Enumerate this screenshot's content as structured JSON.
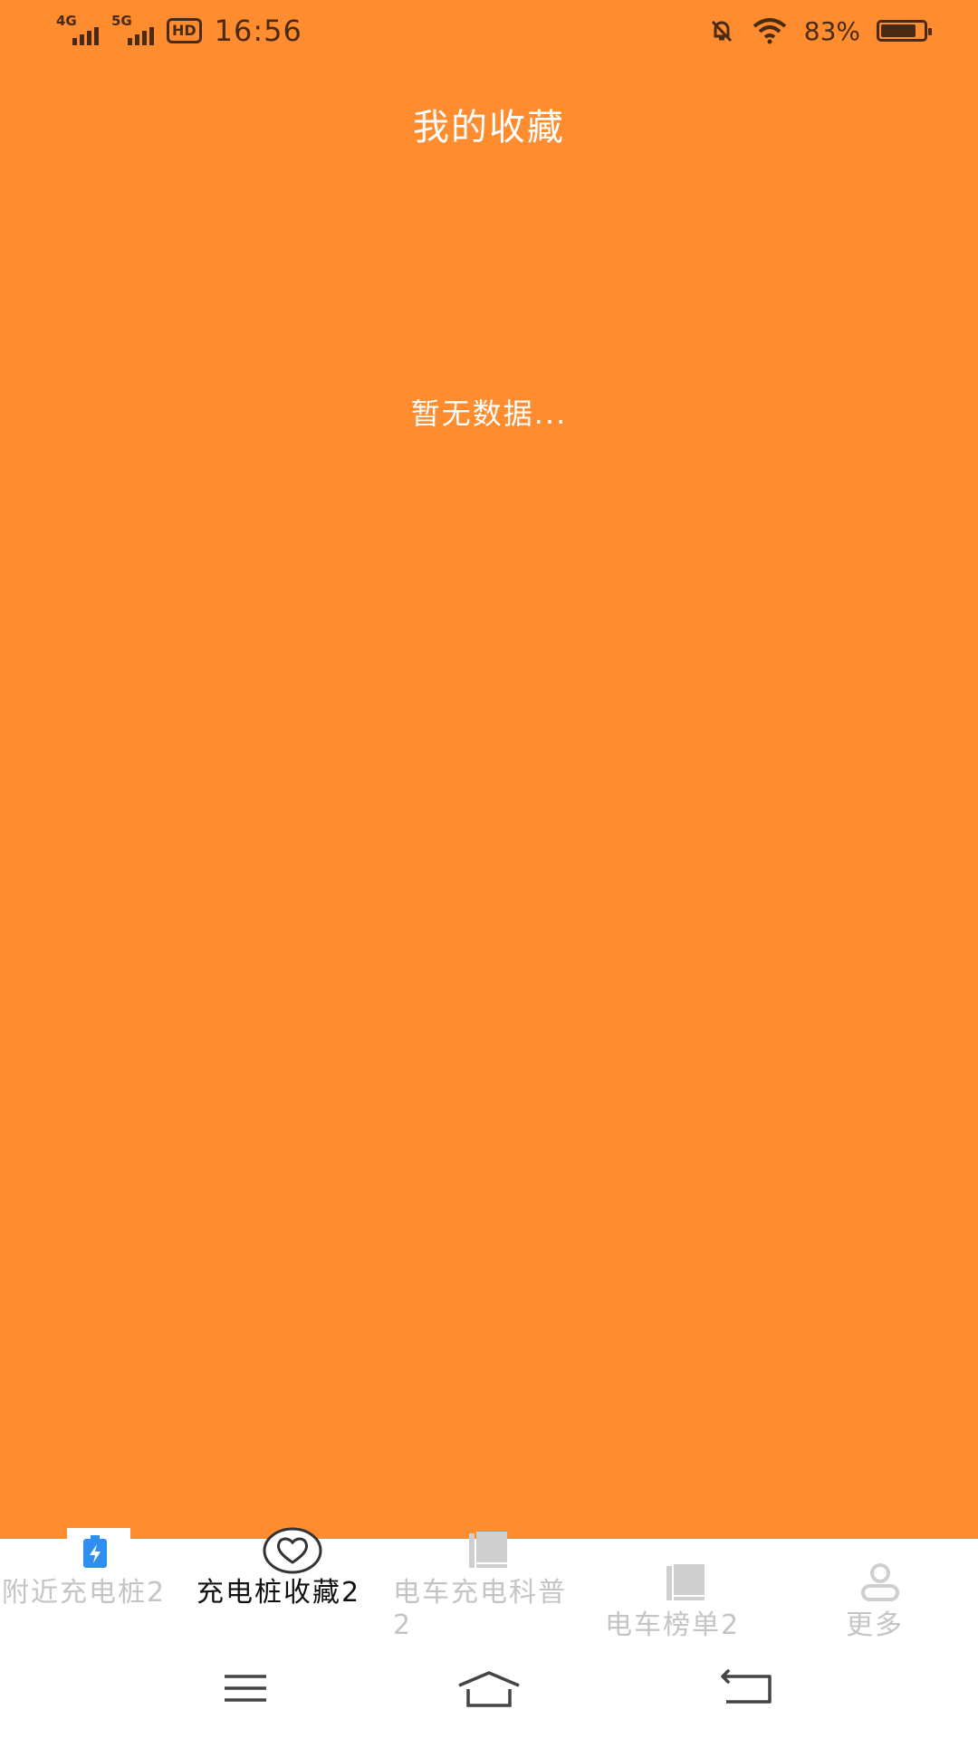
{
  "status_bar": {
    "sim1_network": "4G",
    "sim2_network": "5G",
    "hd_badge": "HD",
    "time": "16:56",
    "battery_percent": "83%",
    "battery_level": 0.83,
    "icons": [
      "signal-icon",
      "mute-bell-icon",
      "wifi-icon",
      "battery-icon"
    ]
  },
  "header": {
    "title": "我的收藏"
  },
  "main": {
    "empty_message": "暂无数据..."
  },
  "bottom_nav": {
    "active_tab": 1,
    "tabs": [
      {
        "label": "附近充电桩2",
        "icon": "charging-pile-icon",
        "active": false
      },
      {
        "label": "充电桩收藏2",
        "icon": "heart-icon",
        "active": true
      },
      {
        "label": "电车充电科普2",
        "icon": "book-icon",
        "active": false
      },
      {
        "label": "电车榜单2",
        "icon": "book-icon",
        "active": false
      },
      {
        "label": "更多",
        "icon": "user-icon",
        "active": false
      }
    ]
  },
  "system_nav": {
    "buttons": [
      "menu-icon",
      "home-icon",
      "back-icon"
    ]
  },
  "colors": {
    "background": "#ff8c2f",
    "active_tab_text": "#111111",
    "inactive_tab_text": "#c4c4c4",
    "accent_blue": "#2f8ff0"
  }
}
